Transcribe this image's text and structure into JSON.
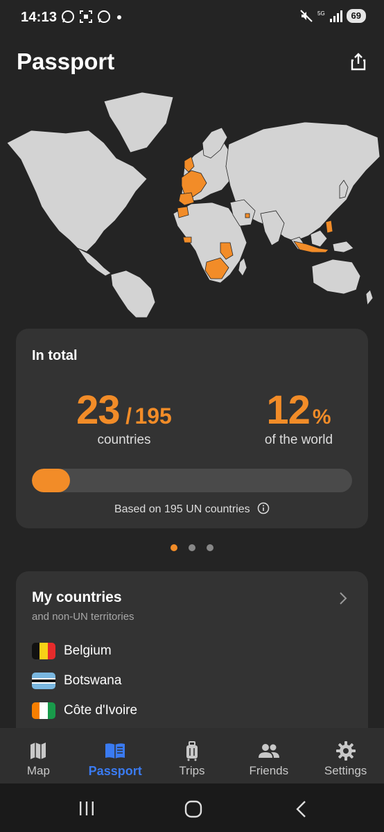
{
  "status": {
    "time": "14:13",
    "battery": "69"
  },
  "header": {
    "title": "Passport"
  },
  "total": {
    "title": "In total",
    "visited": "23",
    "separator": "/",
    "total": "195",
    "countries_label": "countries",
    "percent": "12",
    "percent_unit": "%",
    "world_label": "of the world",
    "progress_fraction": 0.12,
    "basis": "Based on 195 UN countries"
  },
  "pager": {
    "count": 3,
    "active": 0
  },
  "my_countries": {
    "title": "My countries",
    "subtitle": "and non-UN territories",
    "items": [
      {
        "name": "Belgium",
        "flag": [
          "#111111",
          "#f7d117",
          "#e62b2b"
        ]
      },
      {
        "name": "Botswana",
        "flag": [
          "#7ab7e0",
          "#ffffff",
          "#111111"
        ]
      },
      {
        "name": "Côte d'Ivoire",
        "flag": [
          "#f77f00",
          "#ffffff",
          "#199a4a"
        ]
      }
    ]
  },
  "nav": {
    "items": [
      {
        "label": "Map",
        "icon": "map-icon",
        "active": false
      },
      {
        "label": "Passport",
        "icon": "passport-book-icon",
        "active": true
      },
      {
        "label": "Trips",
        "icon": "luggage-icon",
        "active": false
      },
      {
        "label": "Friends",
        "icon": "people-icon",
        "active": false
      },
      {
        "label": "Settings",
        "icon": "gear-icon",
        "active": false
      }
    ]
  },
  "colors": {
    "accent": "#f28c28",
    "active_nav": "#3a7bf2",
    "land": "#d3d3d3",
    "visited": "#f28c28"
  }
}
